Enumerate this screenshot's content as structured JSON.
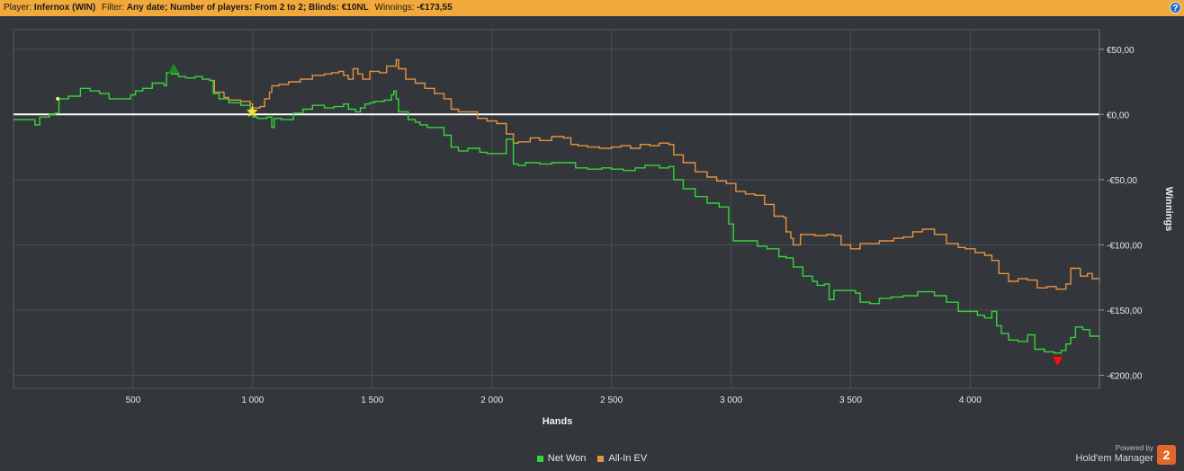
{
  "header": {
    "player_label": "Player:",
    "player_value": "Infernox (WIN)",
    "filter_label": "Filter:",
    "filter_value": "Any date; Number of players: From 2 to 2; Blinds: €10NL",
    "winnings_label": "Winnings:",
    "winnings_value": "-€173,55",
    "help_glyph": "?"
  },
  "brand": {
    "powered_by": "Powered by",
    "name": "Hold'em Manager",
    "badge": "2"
  },
  "colors": {
    "net_won": "#35d43a",
    "all_in_ev": "#e8913f",
    "zero_line": "#ffffff",
    "header_bg": "#f1a93c",
    "plot_bg": "#33373b",
    "grid": "#4a4f53"
  },
  "chart_data": {
    "type": "line",
    "xlabel": "Hands",
    "ylabel": "Winnings",
    "xlim": [
      0,
      4540
    ],
    "ylim": [
      -210,
      65
    ],
    "x_ticks": [
      500,
      1000,
      1500,
      2000,
      2500,
      3000,
      3500,
      4000
    ],
    "x_tick_labels": [
      "500",
      "1 000",
      "1 500",
      "2 000",
      "2 500",
      "3 000",
      "3 500",
      "4 000"
    ],
    "y_ticks": [
      50,
      0,
      -50,
      -100,
      -150,
      -200
    ],
    "y_tick_labels": [
      "€50,00",
      "€0,00",
      "-€50,00",
      "-€100,00",
      "-€150,00",
      "-€200,00"
    ],
    "grid": true,
    "legend_position": "bottom-center",
    "series": [
      {
        "name": "Net Won",
        "color": "#35d43a",
        "points": [
          [
            0,
            -4
          ],
          [
            90,
            -8
          ],
          [
            110,
            -2
          ],
          [
            150,
            0
          ],
          [
            175,
            1
          ],
          [
            190,
            12
          ],
          [
            230,
            14
          ],
          [
            280,
            20
          ],
          [
            320,
            18
          ],
          [
            360,
            16
          ],
          [
            400,
            12
          ],
          [
            440,
            12
          ],
          [
            490,
            15
          ],
          [
            510,
            18
          ],
          [
            540,
            20
          ],
          [
            560,
            20
          ],
          [
            580,
            24
          ],
          [
            610,
            24
          ],
          [
            630,
            22
          ],
          [
            640,
            32
          ],
          [
            660,
            31
          ],
          [
            690,
            29
          ],
          [
            720,
            28
          ],
          [
            760,
            29
          ],
          [
            790,
            27
          ],
          [
            820,
            26
          ],
          [
            835,
            16
          ],
          [
            860,
            12
          ],
          [
            900,
            9
          ],
          [
            950,
            7
          ],
          [
            990,
            4
          ],
          [
            1000,
            -2
          ],
          [
            1020,
            -3
          ],
          [
            1060,
            -2
          ],
          [
            1080,
            -10
          ],
          [
            1090,
            -3
          ],
          [
            1120,
            -4
          ],
          [
            1170,
            1
          ],
          [
            1210,
            4
          ],
          [
            1250,
            7
          ],
          [
            1300,
            5
          ],
          [
            1340,
            6
          ],
          [
            1380,
            8
          ],
          [
            1400,
            4
          ],
          [
            1430,
            2
          ],
          [
            1450,
            5
          ],
          [
            1470,
            8
          ],
          [
            1490,
            9
          ],
          [
            1510,
            10
          ],
          [
            1550,
            11
          ],
          [
            1580,
            15
          ],
          [
            1590,
            18
          ],
          [
            1600,
            12
          ],
          [
            1610,
            2
          ],
          [
            1650,
            -4
          ],
          [
            1680,
            -6
          ],
          [
            1700,
            -8
          ],
          [
            1730,
            -10
          ],
          [
            1760,
            -10
          ],
          [
            1800,
            -16
          ],
          [
            1830,
            -25
          ],
          [
            1860,
            -28
          ],
          [
            1900,
            -26
          ],
          [
            1950,
            -29
          ],
          [
            1980,
            -30
          ],
          [
            2020,
            -30
          ],
          [
            2060,
            -19
          ],
          [
            2090,
            -38
          ],
          [
            2110,
            -39
          ],
          [
            2140,
            -37
          ],
          [
            2200,
            -38
          ],
          [
            2250,
            -37
          ],
          [
            2300,
            -37
          ],
          [
            2350,
            -41
          ],
          [
            2400,
            -42
          ],
          [
            2460,
            -41
          ],
          [
            2500,
            -42
          ],
          [
            2550,
            -43
          ],
          [
            2600,
            -41
          ],
          [
            2640,
            -39
          ],
          [
            2700,
            -41
          ],
          [
            2740,
            -40
          ],
          [
            2760,
            -50
          ],
          [
            2800,
            -57
          ],
          [
            2850,
            -63
          ],
          [
            2900,
            -68
          ],
          [
            2950,
            -71
          ],
          [
            2990,
            -84
          ],
          [
            3010,
            -97
          ],
          [
            3050,
            -97
          ],
          [
            3080,
            -97
          ],
          [
            3110,
            -101
          ],
          [
            3150,
            -103
          ],
          [
            3200,
            -109
          ],
          [
            3230,
            -110
          ],
          [
            3260,
            -117
          ],
          [
            3300,
            -124
          ],
          [
            3340,
            -128
          ],
          [
            3360,
            -131
          ],
          [
            3390,
            -130
          ],
          [
            3410,
            -142
          ],
          [
            3430,
            -135
          ],
          [
            3470,
            -135
          ],
          [
            3520,
            -137
          ],
          [
            3540,
            -144
          ],
          [
            3580,
            -145
          ],
          [
            3620,
            -141
          ],
          [
            3670,
            -140
          ],
          [
            3720,
            -139
          ],
          [
            3780,
            -136
          ],
          [
            3850,
            -139
          ],
          [
            3900,
            -144
          ],
          [
            3950,
            -151
          ],
          [
            3990,
            -151
          ],
          [
            4030,
            -154
          ],
          [
            4060,
            -156
          ],
          [
            4090,
            -151
          ],
          [
            4110,
            -162
          ],
          [
            4130,
            -168
          ],
          [
            4160,
            -173
          ],
          [
            4200,
            -174
          ],
          [
            4240,
            -169
          ],
          [
            4270,
            -180
          ],
          [
            4310,
            -182
          ],
          [
            4350,
            -183
          ],
          [
            4380,
            -181
          ],
          [
            4400,
            -176
          ],
          [
            4420,
            -171
          ],
          [
            4440,
            -163
          ],
          [
            4470,
            -165
          ],
          [
            4500,
            -170
          ],
          [
            4540,
            -173
          ]
        ]
      },
      {
        "name": "All-In EV",
        "color": "#e8913f",
        "points": [
          [
            820,
            26
          ],
          [
            840,
            17
          ],
          [
            880,
            13
          ],
          [
            900,
            11
          ],
          [
            950,
            10
          ],
          [
            990,
            8
          ],
          [
            1000,
            5
          ],
          [
            1030,
            6
          ],
          [
            1050,
            12
          ],
          [
            1070,
            17
          ],
          [
            1080,
            22
          ],
          [
            1110,
            23
          ],
          [
            1150,
            25
          ],
          [
            1200,
            27
          ],
          [
            1250,
            30
          ],
          [
            1300,
            31
          ],
          [
            1330,
            32
          ],
          [
            1360,
            33
          ],
          [
            1380,
            30
          ],
          [
            1400,
            27
          ],
          [
            1420,
            35
          ],
          [
            1440,
            31
          ],
          [
            1460,
            27
          ],
          [
            1490,
            33
          ],
          [
            1530,
            32
          ],
          [
            1560,
            37
          ],
          [
            1600,
            42
          ],
          [
            1610,
            35
          ],
          [
            1640,
            27
          ],
          [
            1680,
            24
          ],
          [
            1720,
            20
          ],
          [
            1760,
            16
          ],
          [
            1800,
            12
          ],
          [
            1830,
            4
          ],
          [
            1860,
            2
          ],
          [
            1900,
            2
          ],
          [
            1940,
            -3
          ],
          [
            1980,
            -5
          ],
          [
            2020,
            -7
          ],
          [
            2060,
            -15
          ],
          [
            2090,
            -22
          ],
          [
            2110,
            -21
          ],
          [
            2160,
            -18
          ],
          [
            2200,
            -20
          ],
          [
            2250,
            -17
          ],
          [
            2300,
            -18
          ],
          [
            2330,
            -23
          ],
          [
            2360,
            -24
          ],
          [
            2400,
            -25
          ],
          [
            2450,
            -26
          ],
          [
            2500,
            -25
          ],
          [
            2540,
            -24
          ],
          [
            2580,
            -26
          ],
          [
            2620,
            -23
          ],
          [
            2660,
            -24
          ],
          [
            2700,
            -22
          ],
          [
            2740,
            -23
          ],
          [
            2760,
            -31
          ],
          [
            2800,
            -37
          ],
          [
            2850,
            -44
          ],
          [
            2900,
            -48
          ],
          [
            2940,
            -51
          ],
          [
            2980,
            -53
          ],
          [
            3020,
            -59
          ],
          [
            3060,
            -61
          ],
          [
            3100,
            -62
          ],
          [
            3140,
            -69
          ],
          [
            3180,
            -78
          ],
          [
            3220,
            -79
          ],
          [
            3230,
            -90
          ],
          [
            3250,
            -95
          ],
          [
            3260,
            -100
          ],
          [
            3290,
            -92
          ],
          [
            3330,
            -92
          ],
          [
            3350,
            -93
          ],
          [
            3400,
            -92
          ],
          [
            3430,
            -93
          ],
          [
            3460,
            -100
          ],
          [
            3500,
            -103
          ],
          [
            3540,
            -99
          ],
          [
            3580,
            -99
          ],
          [
            3620,
            -97
          ],
          [
            3680,
            -95
          ],
          [
            3720,
            -94
          ],
          [
            3760,
            -90
          ],
          [
            3800,
            -88
          ],
          [
            3850,
            -92
          ],
          [
            3900,
            -99
          ],
          [
            3950,
            -102
          ],
          [
            3980,
            -103
          ],
          [
            4020,
            -106
          ],
          [
            4060,
            -108
          ],
          [
            4090,
            -112
          ],
          [
            4120,
            -122
          ],
          [
            4160,
            -128
          ],
          [
            4200,
            -126
          ],
          [
            4240,
            -127
          ],
          [
            4280,
            -133
          ],
          [
            4320,
            -132
          ],
          [
            4360,
            -134
          ],
          [
            4400,
            -130
          ],
          [
            4420,
            -118
          ],
          [
            4460,
            -124
          ],
          [
            4490,
            -122
          ],
          [
            4510,
            -126
          ],
          [
            4540,
            -128
          ]
        ]
      }
    ],
    "markers": [
      {
        "type": "triangle-up",
        "color": "#1f8a1f",
        "x": 670,
        "y": 35
      },
      {
        "type": "star",
        "color": "#f5e33a",
        "x": 998,
        "y": 2
      },
      {
        "type": "triangle-down",
        "color": "#e01a1a",
        "x": 4365,
        "y": -189
      },
      {
        "type": "dot",
        "color": "#f5f07a",
        "x": 185,
        "y": 12
      }
    ]
  }
}
